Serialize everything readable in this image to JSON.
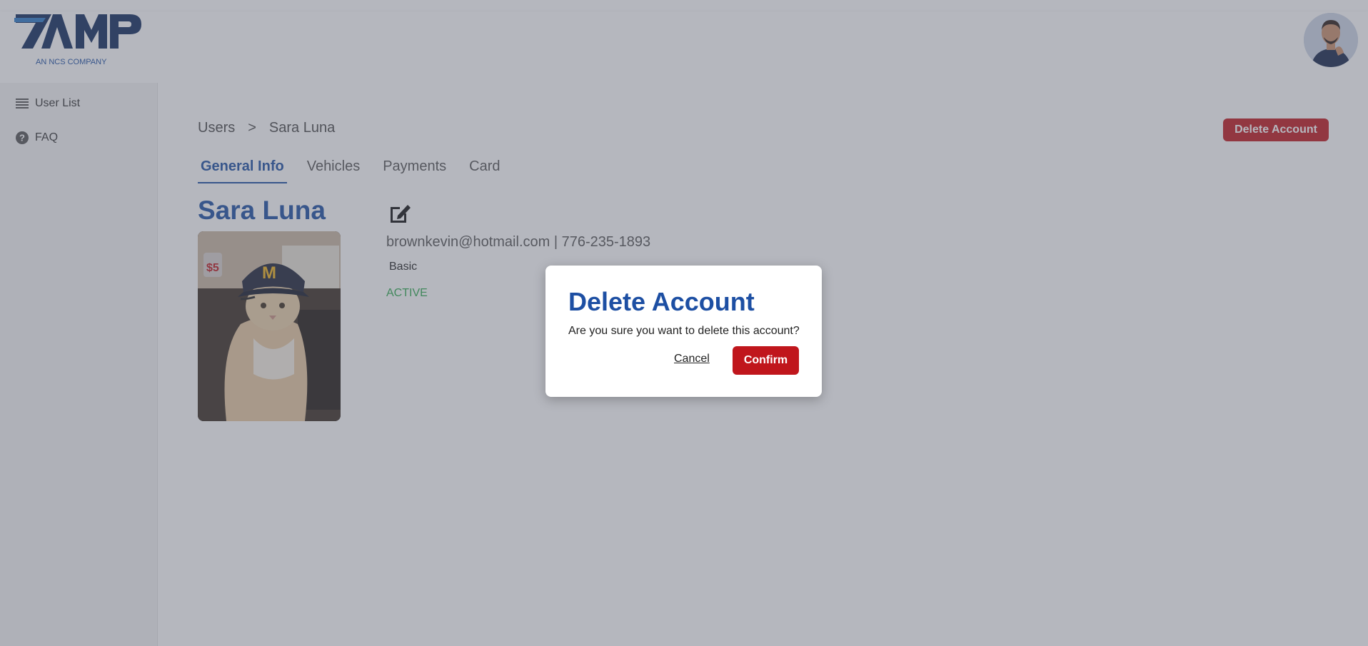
{
  "brand": {
    "logo_text": "AMP",
    "logo_sub": "AN NCS COMPANY",
    "color": "#1d4fa3"
  },
  "header": {
    "avatar_icon": "user-avatar"
  },
  "sidebar": {
    "items": [
      {
        "label": "User List",
        "icon": "list-icon"
      },
      {
        "label": "FAQ",
        "icon": "help-circle-icon"
      }
    ]
  },
  "breadcrumb": {
    "root": "Users",
    "separator": ">",
    "current": "Sara Luna"
  },
  "tabs": [
    {
      "label": "General Info",
      "active": true
    },
    {
      "label": "Vehicles",
      "active": false
    },
    {
      "label": "Payments",
      "active": false
    },
    {
      "label": "Card",
      "active": false
    }
  ],
  "actions": {
    "delete_account": "Delete Account"
  },
  "profile": {
    "name": "Sara Luna",
    "contact": "brownkevin@hotmail.com | 776-235-1893",
    "plan": "Basic",
    "status": "ACTIVE",
    "status_color": "#2faa4f"
  },
  "modal": {
    "title": "Delete Account",
    "message": "Are you sure you want to delete this account?",
    "cancel": "Cancel",
    "confirm": "Confirm",
    "confirm_color": "#c0161c"
  }
}
